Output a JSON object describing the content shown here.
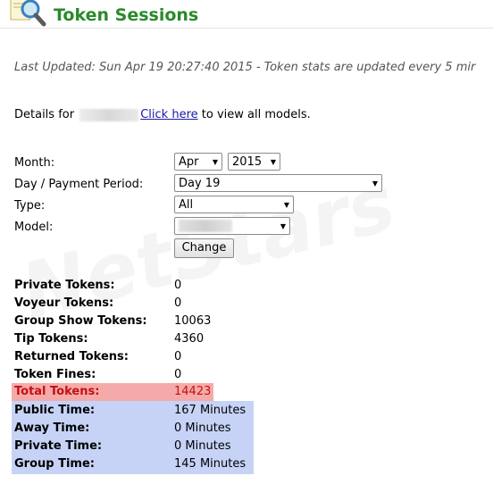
{
  "header": {
    "title": "Token Sessions",
    "icon": "magnifier-document-icon"
  },
  "last_updated": "Last Updated: Sun Apr 19 20:27:40 2015 - Token stats are updated every 5 mir",
  "details": {
    "prefix": "Details for",
    "link_text": "Click here",
    "suffix": "to view all models."
  },
  "form": {
    "month_label": "Month:",
    "month_value": "Apr",
    "year_value": "2015",
    "day_label": "Day / Payment Period:",
    "day_value": "Day 19",
    "type_label": "Type:",
    "type_value": "All",
    "model_label": "Model:",
    "change_button": "Change"
  },
  "stats": [
    {
      "label": "Private Tokens:",
      "value": "0"
    },
    {
      "label": "Voyeur Tokens:",
      "value": "0"
    },
    {
      "label": "Group Show Tokens:",
      "value": "10063"
    },
    {
      "label": "Tip Tokens:",
      "value": "4360"
    },
    {
      "label": "Returned Tokens:",
      "value": "0"
    },
    {
      "label": "Token Fines:",
      "value": "0"
    }
  ],
  "total": {
    "label": "Total Tokens:",
    "value": "14423"
  },
  "times": [
    {
      "label": "Public Time:",
      "value": "167 Minutes"
    },
    {
      "label": "Away Time:",
      "value": "0 Minutes"
    },
    {
      "label": "Private Time:",
      "value": "0 Minutes"
    },
    {
      "label": "Group Time:",
      "value": "145 Minutes"
    }
  ],
  "colors": {
    "title": "#2a8a2a",
    "total_bg": "#f5aaaa",
    "total_text": "#c41010",
    "time_bg": "#c6d3f7",
    "link": "#1a1aa6"
  }
}
